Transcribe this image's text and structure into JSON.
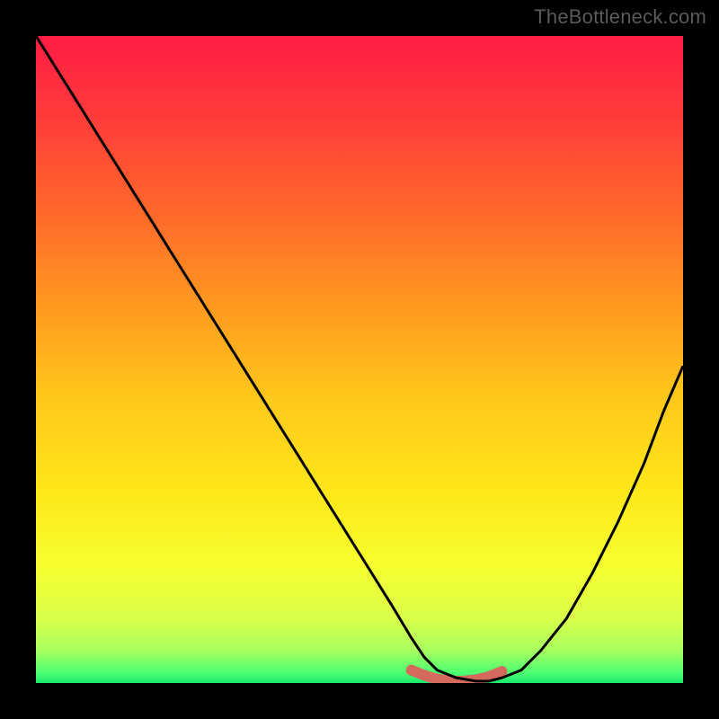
{
  "watermark": {
    "text": "TheBottleneck.com"
  },
  "chart_data": {
    "type": "line",
    "title": "",
    "xlabel": "",
    "ylabel": "",
    "xlim": [
      0,
      100
    ],
    "ylim": [
      0,
      100
    ],
    "grid": false,
    "legend": false,
    "series": [
      {
        "name": "curve",
        "x": [
          0,
          5,
          10,
          15,
          20,
          25,
          30,
          35,
          40,
          45,
          50,
          55,
          58,
          60,
          62,
          65,
          68,
          70,
          72,
          75,
          78,
          82,
          86,
          90,
          94,
          97,
          100
        ],
        "y": [
          100,
          92,
          84,
          76,
          68,
          60,
          52,
          44,
          36,
          28,
          20,
          12,
          7,
          4,
          2,
          0.8,
          0.3,
          0.3,
          0.8,
          2,
          5,
          10,
          17,
          25,
          34,
          42,
          49
        ]
      },
      {
        "name": "highlight-band",
        "x": [
          58,
          60,
          62,
          64,
          66,
          68,
          70,
          72
        ],
        "y": [
          2.0,
          1.2,
          0.6,
          0.3,
          0.3,
          0.5,
          1.0,
          1.8
        ]
      }
    ],
    "gradient_stops": [
      {
        "offset": 0.0,
        "color": "#ff1c44"
      },
      {
        "offset": 0.12,
        "color": "#ff3a3a"
      },
      {
        "offset": 0.28,
        "color": "#ff6a2a"
      },
      {
        "offset": 0.42,
        "color": "#ff9a1f"
      },
      {
        "offset": 0.56,
        "color": "#ffc81a"
      },
      {
        "offset": 0.7,
        "color": "#ffe619"
      },
      {
        "offset": 0.82,
        "color": "#f6ff2f"
      },
      {
        "offset": 0.9,
        "color": "#d9ff4a"
      },
      {
        "offset": 0.95,
        "color": "#a7ff5e"
      },
      {
        "offset": 0.985,
        "color": "#4bff72"
      },
      {
        "offset": 1.0,
        "color": "#16e86a"
      }
    ],
    "highlight_color": "#d46a5e",
    "curve_color": "#000000"
  }
}
